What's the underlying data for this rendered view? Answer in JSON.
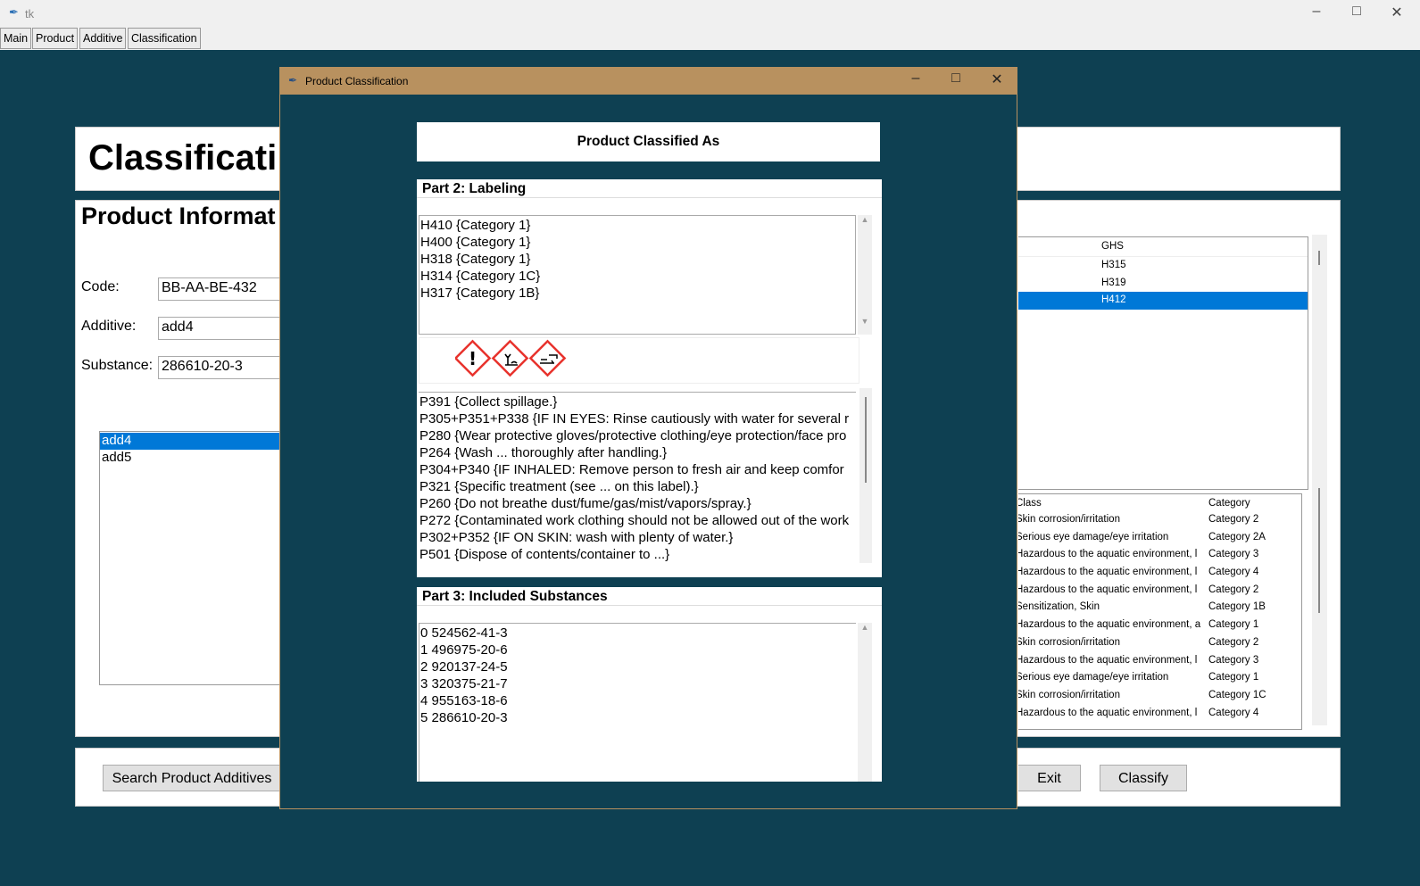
{
  "window": {
    "title": "tk"
  },
  "tabs": [
    "Main",
    "Product",
    "Additive",
    "Classification"
  ],
  "main": {
    "heading": "Classificati",
    "product_info_title": "Product Informat",
    "code_label": "Code:",
    "code_value": "BB-AA-BE-432",
    "additive_label": "Additive:",
    "additive_value": "add4",
    "substance_label": "Substance:",
    "substance_value": "286610-20-3",
    "additive_list": [
      "add4",
      "add5"
    ],
    "ghs_header": "GHS",
    "ghs_rows": [
      "H315",
      "H319",
      "H412"
    ],
    "class_header": "Class",
    "category_header": "Category",
    "class_rows": [
      [
        "Skin corrosion/irritation",
        "Category 2"
      ],
      [
        "Serious eye damage/eye irritation",
        "Category 2A"
      ],
      [
        "Hazardous to the aquatic environment, l",
        "Category 3"
      ],
      [
        "Hazardous to the aquatic environment, l",
        "Category 4"
      ],
      [
        "Hazardous to the aquatic environment, l",
        "Category 2"
      ],
      [
        "Sensitization, Skin",
        "Category 1B"
      ],
      [
        "Hazardous to the aquatic environment, a",
        "Category 1"
      ],
      [
        "Skin corrosion/irritation",
        "Category 2"
      ],
      [
        "Hazardous to the aquatic environment, l",
        "Category 3"
      ],
      [
        "Serious eye damage/eye irritation",
        "Category 1"
      ],
      [
        "Skin corrosion/irritation",
        "Category 1C"
      ],
      [
        "Hazardous to the aquatic environment, l",
        "Category 4"
      ]
    ],
    "search_button": "Search Product Additives",
    "exit_button": "Exit",
    "classify_button": "Classify"
  },
  "dialog": {
    "title": "Product Classification",
    "header": "Product Classified As",
    "part2_title": "Part 2: Labeling",
    "hazard_statements": [
      "H410 {Category 1}",
      "H400 {Category 1}",
      "H318 {Category 1}",
      "H314 {Category 1C}",
      "H317 {Category 1B}"
    ],
    "pictograms": [
      "exclamation-mark",
      "environment",
      "corrosion"
    ],
    "precautionary_statements": [
      "P391 {Collect spillage.}",
      "P305+P351+P338 {IF IN EYES: Rinse cautiously with water for several r",
      "P280 {Wear protective gloves/protective clothing/eye protection/face pro",
      "P264 {Wash ... thoroughly after handling.}",
      "P304+P340 {IF INHALED: Remove person to fresh air and keep comfor",
      "P321 {Specific treatment (see ... on this label).}",
      "P260 {Do not breathe dust/fume/gas/mist/vapors/spray.}",
      "P272 {Contaminated work clothing should not be allowed out of the work",
      "P302+P352 {IF ON SKIN: wash with plenty of water.}",
      "P501 {Dispose of contents/container to ...}"
    ],
    "part3_title": "Part 3: Included Substances",
    "substances": [
      "0 524562-41-3",
      "1 496975-20-6",
      "2 920137-24-5",
      "3 320375-21-7",
      "4 955163-18-6",
      "5 286610-20-3"
    ]
  },
  "colors": {
    "background": "#0e4052",
    "dialog_titlebar": "#b8915f",
    "selection": "#0078d7",
    "pictogram_border": "#e8322c"
  }
}
